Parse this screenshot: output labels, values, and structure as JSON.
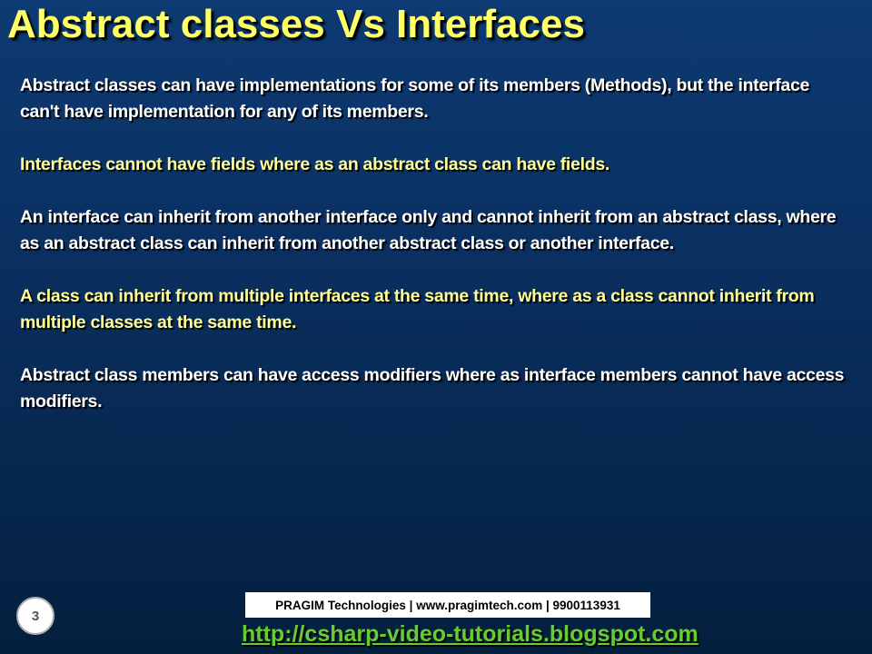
{
  "slide": {
    "title": "Abstract classes Vs Interfaces",
    "paragraphs": [
      "Abstract classes can have implementations for some of its members (Methods), but the interface can't have implementation for any of its members.",
      "Interfaces cannot have fields where as an abstract class can have fields.",
      "An interface can inherit from another interface only and cannot inherit from an abstract class, where as an abstract class can inherit from another abstract class or another interface.",
      "A class can inherit from multiple interfaces at the same time, where as a class cannot inherit from multiple classes at the same time.",
      "Abstract class members can have access modifiers where as interface members cannot have access modifiers."
    ],
    "number": "3"
  },
  "footer": {
    "company": "PRAGIM Technologies | www.pragimtech.com | 9900113931",
    "link": "http://csharp-video-tutorials.blogspot.com"
  },
  "colors": {
    "title": "#ffff66",
    "highlight_text": "#ffff99",
    "body_text": "#ffffff",
    "link": "#66cc33",
    "background": "#0a2f60"
  }
}
